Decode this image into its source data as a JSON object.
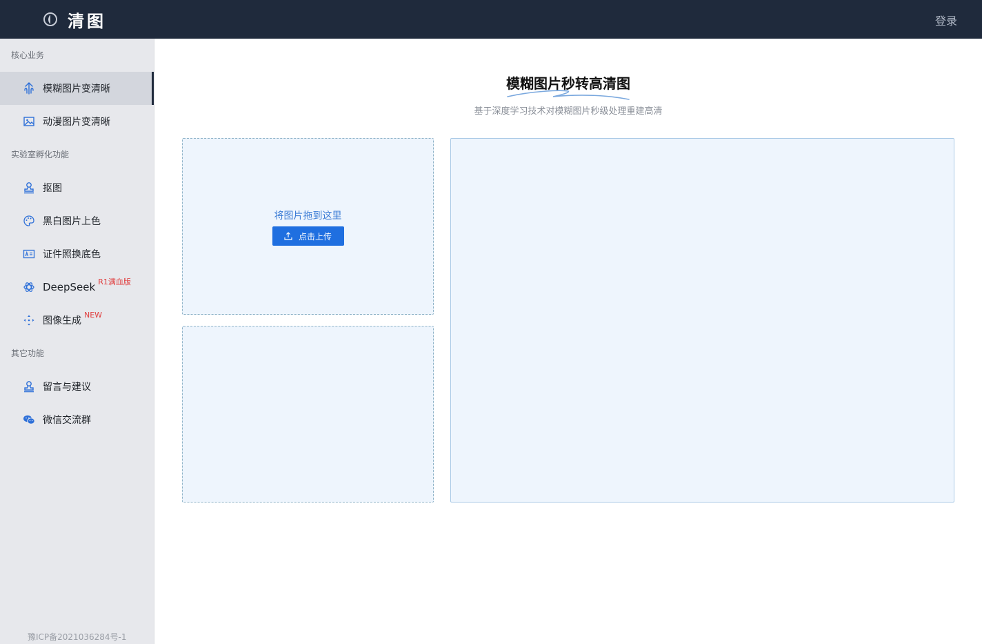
{
  "header": {
    "brand": "清图",
    "login": "登录"
  },
  "sidebar": {
    "sections": [
      {
        "title": "核心业务",
        "items": [
          {
            "label": "模糊图片变清晰",
            "icon": "image-enhance-icon"
          },
          {
            "label": "动漫图片变清晰",
            "icon": "picture-icon"
          }
        ]
      },
      {
        "title": "实验室孵化功能",
        "items": [
          {
            "label": "抠图",
            "icon": "person-stamp-icon"
          },
          {
            "label": "黑白图片上色",
            "icon": "palette-icon"
          },
          {
            "label": "证件照换底色",
            "icon": "id-card-icon"
          },
          {
            "label": "DeepSeek",
            "icon": "openai-knot-icon",
            "tag": "R1满血版"
          },
          {
            "label": "图像生成",
            "icon": "move-arrows-icon",
            "tag": "NEW"
          }
        ]
      },
      {
        "title": "其它功能",
        "items": [
          {
            "label": "留言与建议",
            "icon": "person-stamp-icon"
          },
          {
            "label": "微信交流群",
            "icon": "wechat-icon"
          }
        ]
      }
    ],
    "icp": "豫ICP备2021036284号-1"
  },
  "main": {
    "title": "模糊图片秒转高清图",
    "subtitle": "基于深度学习技术对模糊图片秒级处理重建高清",
    "upload": {
      "drop_text": "将图片拖到这里",
      "button_label": "点击上传"
    }
  },
  "colors": {
    "header_bg": "#1f2a3c",
    "sidebar_bg": "#e7e8ec",
    "accent": "#1f6fe0",
    "tag_red": "#e03f3f",
    "panel_bg": "#eef5fd"
  }
}
